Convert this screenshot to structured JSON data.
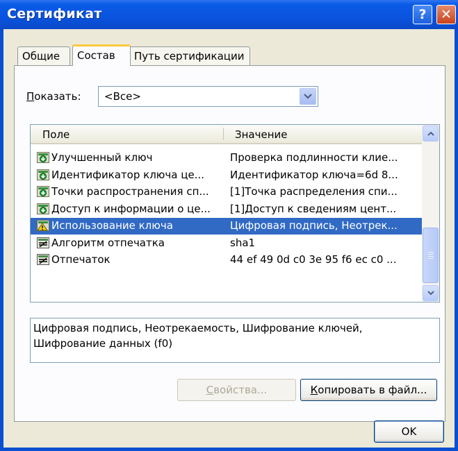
{
  "window": {
    "title": "Сертификат"
  },
  "titlebar": {
    "help_glyph": "?",
    "close_glyph": "✕"
  },
  "tabs": [
    {
      "label": "Общие"
    },
    {
      "label": "Состав"
    },
    {
      "label": "Путь сертификации"
    }
  ],
  "active_tab": "Состав",
  "show": {
    "label_underlined": "П",
    "label_rest": "оказать:",
    "value": "<Все>"
  },
  "list": {
    "columns": [
      "Поле",
      "Значение"
    ],
    "rows": [
      {
        "field": "Улучшенный ключ",
        "value": "Проверка подлинности клие...",
        "icon": "extension-icon",
        "selected": false
      },
      {
        "field": "Идентификатор ключа це...",
        "value": "Идентификатор ключа=6d 8...",
        "icon": "extension-icon",
        "selected": false
      },
      {
        "field": "Точки распространения сп...",
        "value": "[1]Точка распределения спи...",
        "icon": "extension-icon",
        "selected": false
      },
      {
        "field": "Доступ к информации о це...",
        "value": "[1]Доступ к сведениям цент...",
        "icon": "extension-icon",
        "selected": false
      },
      {
        "field": "Использование ключа",
        "value": "Цифровая подпись, Неотрек...",
        "icon": "critical-extension-icon",
        "selected": true
      },
      {
        "field": "Алгоритм отпечатка",
        "value": "sha1",
        "icon": "property-icon",
        "selected": false
      },
      {
        "field": "Отпечаток",
        "value": "44 ef 49 0d c0 3e 95 f6 ec c0 ...",
        "icon": "property-icon",
        "selected": false
      }
    ]
  },
  "description": {
    "line1": "Цифровая подпись, Неотрекаемость, Шифрование ключей,",
    "line2": "Шифрование данных (f0)"
  },
  "buttons": {
    "properties": {
      "underlined": "С",
      "rest": "войства..."
    },
    "copy": {
      "underlined": "К",
      "rest": "опировать в файл..."
    },
    "ok": "OK"
  },
  "colors": {
    "selection": "#316ac5",
    "titlebar": "#0a53df",
    "face": "#ece9d8"
  }
}
